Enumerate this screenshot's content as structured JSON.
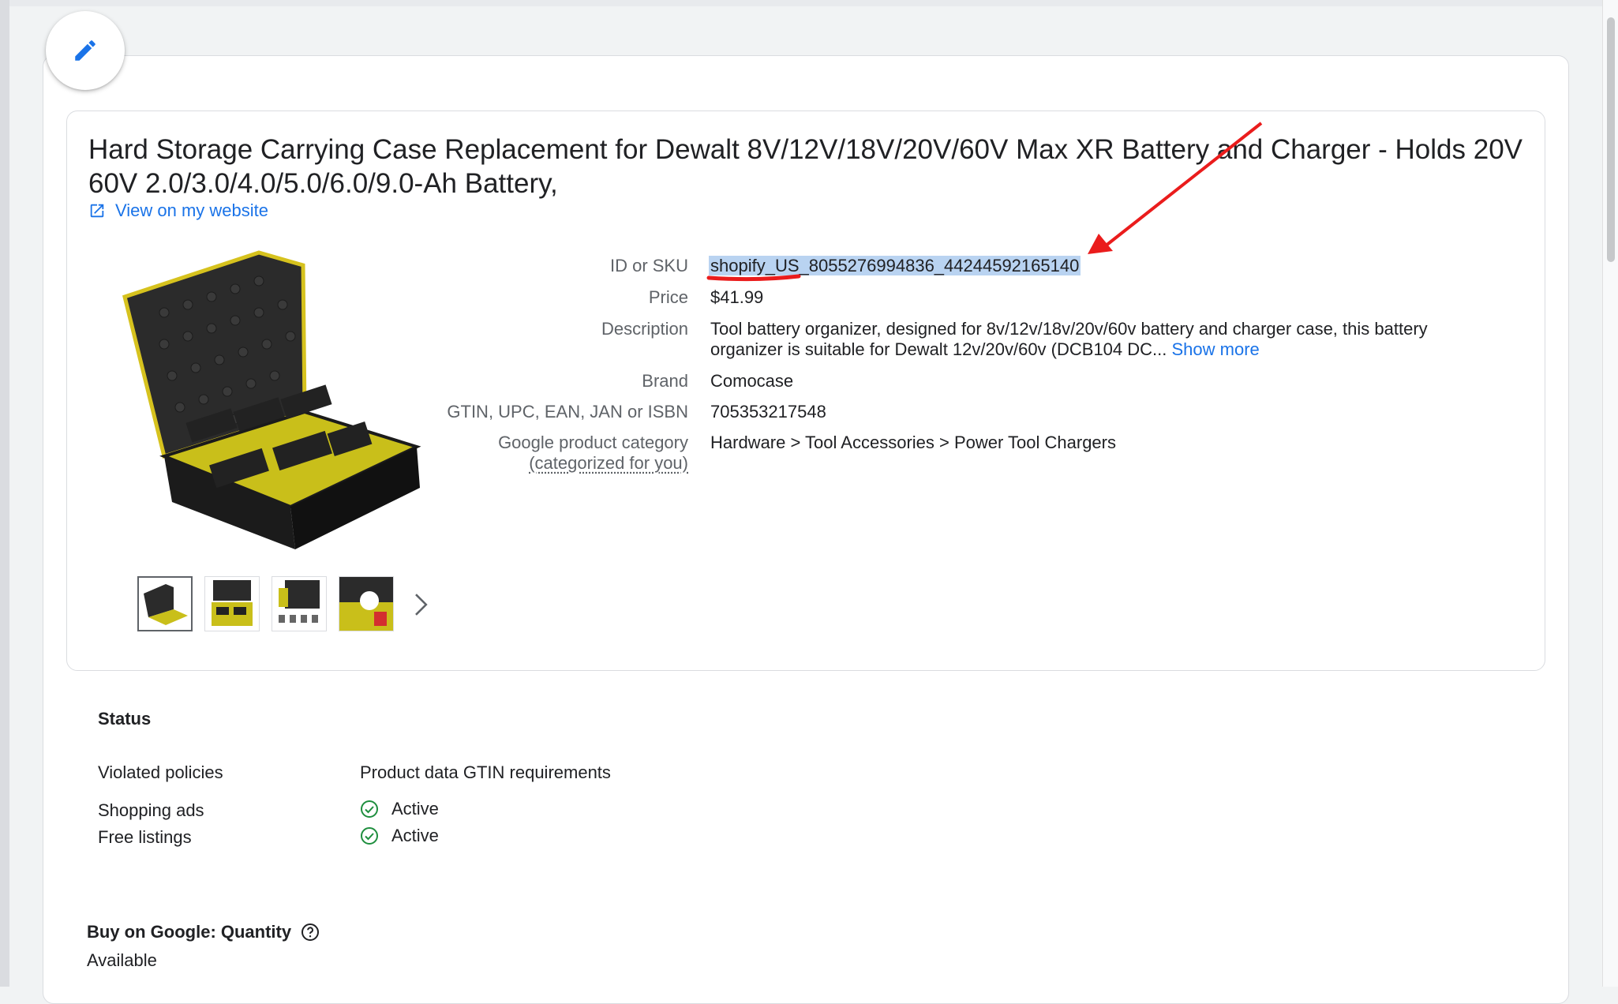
{
  "product": {
    "title": "Hard Storage Carrying Case Replacement for Dewalt 8V/12V/18V/20V/60V Max XR Battery and Charger - Holds 20V 60V 2.0/3.0/4.0/5.0/6.0/9.0-Ah Battery,",
    "view_link": "View on my website"
  },
  "attributes": {
    "sku_label": "ID or SKU",
    "sku_value": "shopify_US_8055276994836_44244592165140",
    "price_label": "Price",
    "price_value": "$41.99",
    "description_label": "Description",
    "description_line1": "Tool battery organizer, designed for 8v/12v/18v/20v/60v battery and charger case, this battery",
    "description_line2": "organizer is suitable for Dewalt 12v/20v/60v (DCB104 DC...",
    "show_more": "Show more",
    "brand_label": "Brand",
    "brand_value": "Comocase",
    "gtin_label": "GTIN, UPC, EAN, JAN or ISBN",
    "gtin_value": "705353217548",
    "category_label": "Google product category",
    "category_sublabel": "(categorized for you)",
    "category_value": "Hardware > Tool Accessories > Power Tool Chargers"
  },
  "status": {
    "heading": "Status",
    "violated_label": "Violated policies",
    "violated_value": "Product data GTIN requirements",
    "shopping_label": "Shopping ads",
    "shopping_value": "Active",
    "free_label": "Free listings",
    "free_value": "Active"
  },
  "buy_on_google": {
    "heading": "Buy on Google: Quantity",
    "value": "Available"
  },
  "colors": {
    "link": "#1a73e8",
    "active_green": "#1e8e3e",
    "annotation_red": "#ea1c1c",
    "selection": "#b9d3f1"
  },
  "icons": [
    "pencil-icon",
    "external-link-icon",
    "chevron-right-icon",
    "check-circle-icon",
    "help-circle-icon"
  ]
}
